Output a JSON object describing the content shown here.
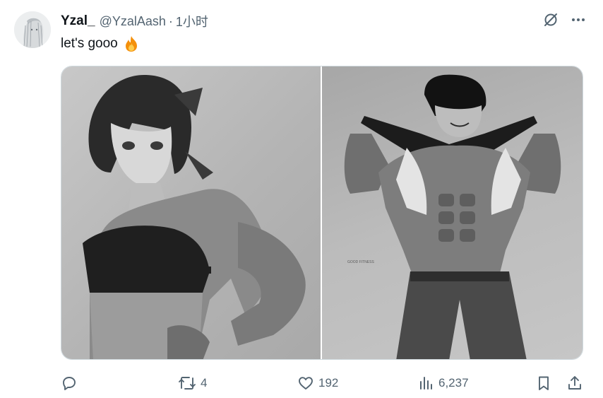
{
  "tweet": {
    "author": {
      "display_name": "Yzal_",
      "handle": "@YzalAash",
      "separator": "·",
      "time": "1小时"
    },
    "text": "let's gooo",
    "emoji": "fire-icon",
    "media": [
      {
        "name": "photo-left",
        "kind": "grayscale-photo"
      },
      {
        "name": "photo-right",
        "kind": "grayscale-photo"
      }
    ],
    "watermark": "GOOD FITNESS",
    "actions": {
      "reply": {
        "icon": "reply-icon",
        "count": ""
      },
      "retweet": {
        "icon": "retweet-icon",
        "count": "4"
      },
      "like": {
        "icon": "heart-icon",
        "count": "192"
      },
      "views": {
        "icon": "views-icon",
        "count": "6,237"
      },
      "bookmark": {
        "icon": "bookmark-icon"
      },
      "share": {
        "icon": "share-icon"
      }
    }
  },
  "colors": {
    "text_primary": "#0f1419",
    "text_secondary": "#536471",
    "border": "#cfd9de",
    "fire": "#f4900c"
  }
}
